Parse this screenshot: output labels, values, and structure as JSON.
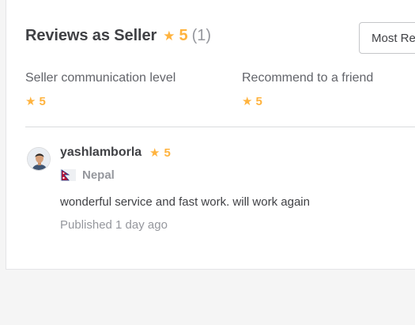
{
  "header": {
    "title": "Reviews as Seller",
    "rating": "5",
    "count": "(1)"
  },
  "sort": {
    "label": "Most Re"
  },
  "breakdown": [
    {
      "label": "Seller communication level",
      "rating": "5"
    },
    {
      "label": "Recommend to a friend",
      "rating": "5"
    }
  ],
  "review": {
    "username": "yashlamborla",
    "rating": "5",
    "country": "Nepal",
    "text": "wonderful service and fast work. will work again",
    "published": "Published 1 day ago"
  },
  "icons": {
    "star": "star-icon",
    "flag": "nepal-flag-icon",
    "avatar": "user-avatar"
  },
  "colors": {
    "star": "#ffb33e",
    "text": "#404145",
    "muted": "#95979d",
    "background": "#f5f5f5",
    "card": "#ffffff"
  }
}
